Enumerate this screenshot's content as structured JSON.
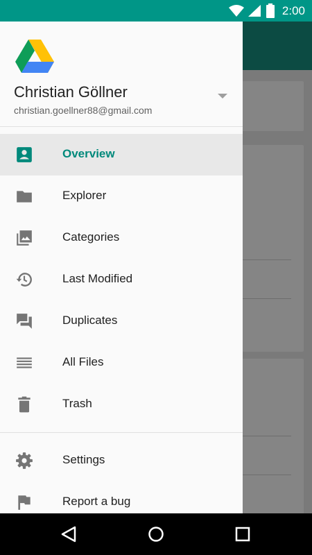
{
  "status_bar": {
    "time": "2:00",
    "color": "#009687"
  },
  "account": {
    "name": "Christian Göllner",
    "email": "christian.goellner88@gmail.com"
  },
  "menu": {
    "primary": [
      {
        "label": "Overview",
        "icon": "account-box-icon",
        "active": true
      },
      {
        "label": "Explorer",
        "icon": "folder-icon"
      },
      {
        "label": "Categories",
        "icon": "photo-library-icon"
      },
      {
        "label": "Last Modified",
        "icon": "history-icon"
      },
      {
        "label": "Duplicates",
        "icon": "forum-icon"
      },
      {
        "label": "All Files",
        "icon": "list-icon"
      },
      {
        "label": "Trash",
        "icon": "delete-icon"
      }
    ],
    "secondary": [
      {
        "label": "Settings",
        "icon": "settings-icon"
      },
      {
        "label": "Report a bug",
        "icon": "flag-icon"
      }
    ]
  },
  "colors": {
    "accent": "#00897b",
    "toolbar": "#0c4b43"
  },
  "nav": [
    "back-icon",
    "home-icon",
    "recents-icon"
  ]
}
